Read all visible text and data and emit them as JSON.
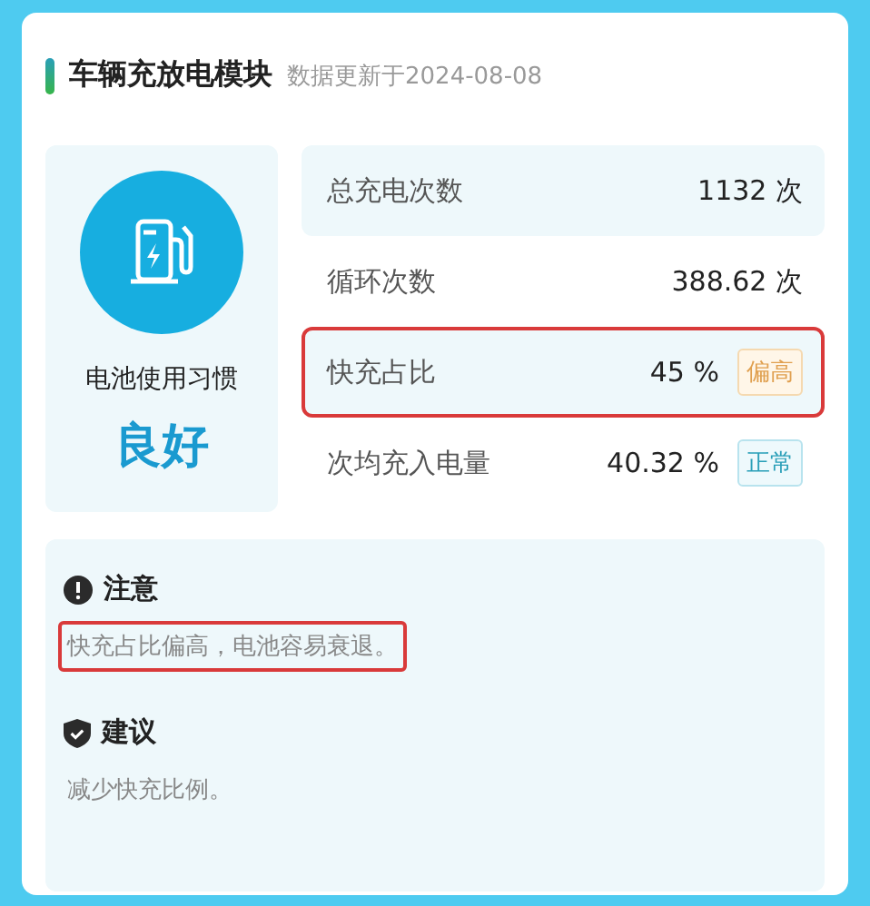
{
  "header": {
    "title": "车辆充放电模块",
    "updated": "数据更新于2024-08-08"
  },
  "habit": {
    "label": "电池使用习惯",
    "rating": "良好"
  },
  "stats": [
    {
      "label": "总充电次数",
      "value": "1132 次",
      "highlighted": false
    },
    {
      "label": "循环次数",
      "value": "388.62 次",
      "highlighted": false
    },
    {
      "label": "快充占比",
      "value": "45 %",
      "highlighted": true,
      "tag": {
        "text": "偏高",
        "kind": "warn"
      }
    },
    {
      "label": "次均充入电量",
      "value": "40.32 %",
      "highlighted": false,
      "tag": {
        "text": "正常",
        "kind": "normal"
      }
    }
  ],
  "sections": [
    {
      "kind": "notice",
      "title": "注意",
      "text": "快充占比偏高，电池容易衰退。",
      "highlighted": true
    },
    {
      "kind": "advice",
      "title": "建议",
      "text": "减少快充比例。",
      "highlighted": false
    }
  ]
}
